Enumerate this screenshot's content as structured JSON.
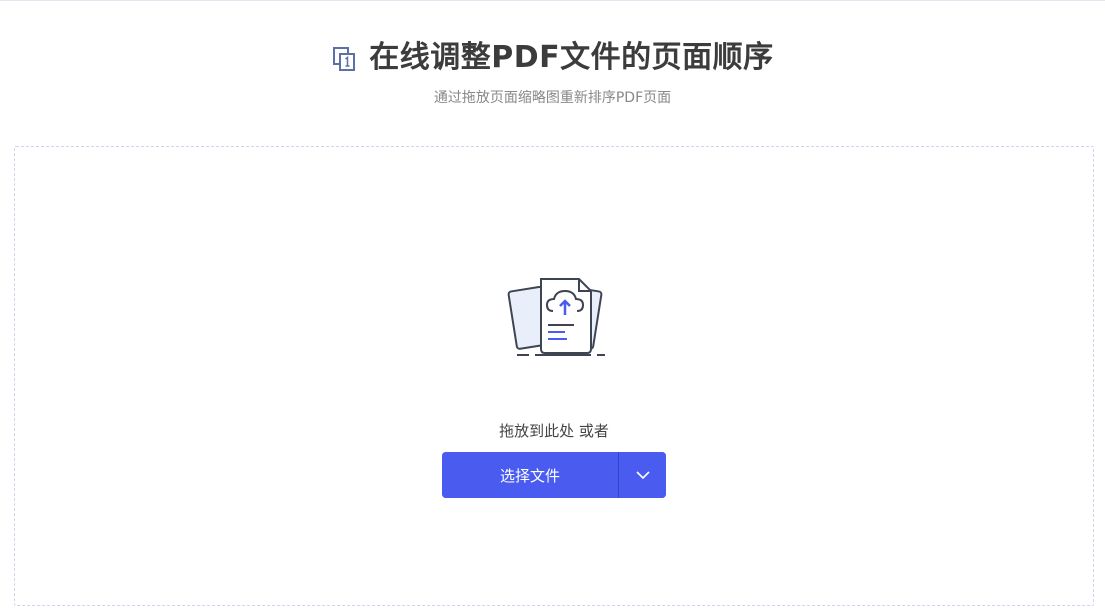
{
  "header": {
    "title": "在线调整PDF文件的页面顺序",
    "subtitle": "通过拖放页面缩略图重新排序PDF页面",
    "icon": "reorder-pages-icon"
  },
  "dropzone": {
    "hint": "拖放到此处 或者",
    "illustration": "upload-documents-icon",
    "choose_label": "选择文件",
    "dropdown_icon": "chevron-down-icon"
  },
  "colors": {
    "accent": "#4a5cf0",
    "title": "#3c3c3c",
    "subtitle": "#888888",
    "border": "#cfd5ea"
  }
}
